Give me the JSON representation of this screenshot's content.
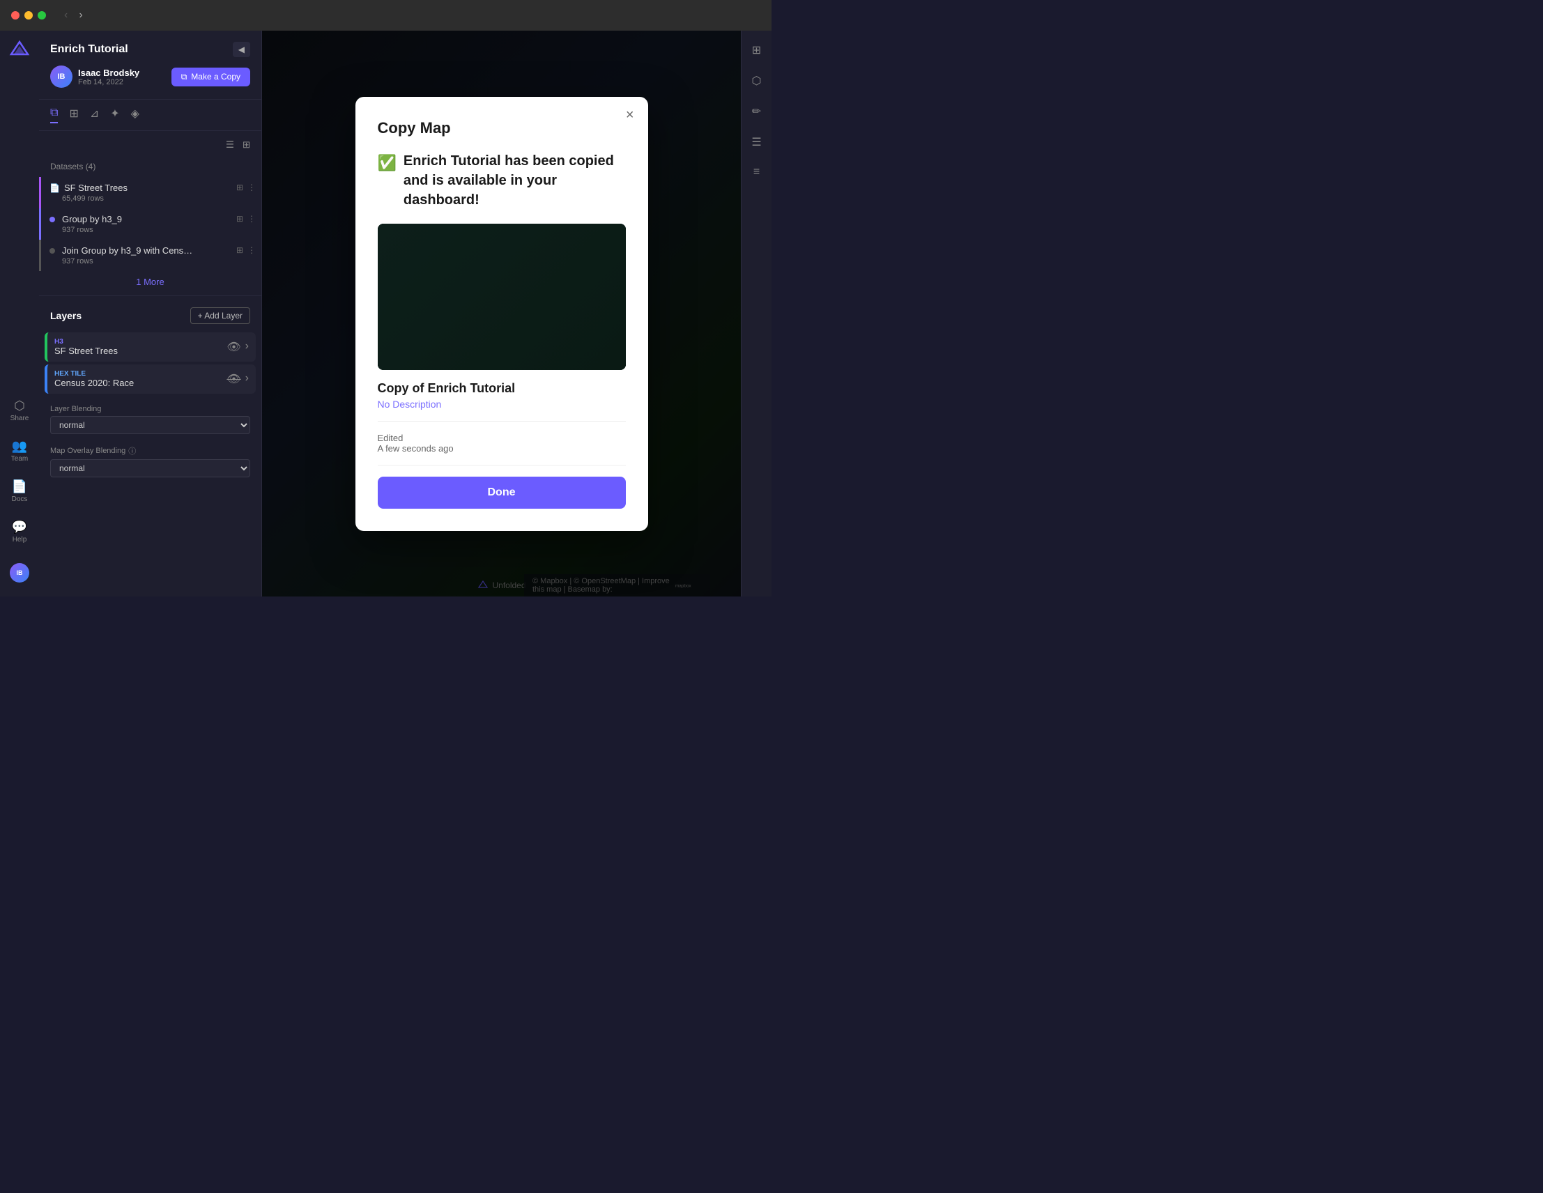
{
  "titlebar": {
    "title": "Enrich Tutorial",
    "nav_back": "‹",
    "nav_forward": "›"
  },
  "author": {
    "name": "Isaac Brodsky",
    "date": "Feb 14, 2022",
    "avatar_initials": "IB",
    "copy_button": "Make a Copy"
  },
  "toolbar": {
    "icons": [
      "layers",
      "table",
      "filter",
      "effects",
      "map"
    ]
  },
  "datasets": {
    "label": "Datasets (4)",
    "items": [
      {
        "name": "SF Street Trees",
        "rows": "65,499 rows",
        "active": true
      },
      {
        "name": "Group by h3_9",
        "rows": "937 rows",
        "active": false
      },
      {
        "name": "Join Group by h3_9 with Cens…",
        "rows": "937 rows",
        "active": false
      }
    ],
    "more_link": "1 More"
  },
  "layers": {
    "title": "Layers",
    "add_button": "+ Add Layer",
    "items": [
      {
        "type": "H3",
        "name": "SF Street Trees",
        "color": "green"
      },
      {
        "type": "Hex Tile",
        "name": "Census 2020: Race",
        "color": "blue"
      }
    ]
  },
  "blending": {
    "label": "Layer Blending",
    "value": "normal",
    "overlay_label": "Map Overlay Blending",
    "overlay_value": "normal"
  },
  "sidebar_nav": [
    {
      "icon": "🔗",
      "label": "Share"
    },
    {
      "icon": "👥",
      "label": "Team"
    },
    {
      "icon": "📄",
      "label": "Docs"
    },
    {
      "icon": "❓",
      "label": "Help"
    }
  ],
  "modal": {
    "title": "Copy Map",
    "success_message": "Enrich Tutorial has been copied and is available in your dashboard!",
    "success_icon": "✅",
    "close_button": "×",
    "copy_title": "Copy of Enrich Tutorial",
    "copy_desc": "No Description",
    "meta_label": "Edited",
    "meta_value": "A few seconds ago",
    "done_button": "Done"
  },
  "map": {
    "bottom_bar": "© Mapbox | © OpenStreetMap | Improve this map | Basemap by:",
    "watermark": "Unfolded"
  },
  "colors": {
    "accent": "#6b5cff",
    "success": "#22c55e",
    "bg_dark": "#1e1e2e",
    "bg_map": "#0d1117"
  }
}
